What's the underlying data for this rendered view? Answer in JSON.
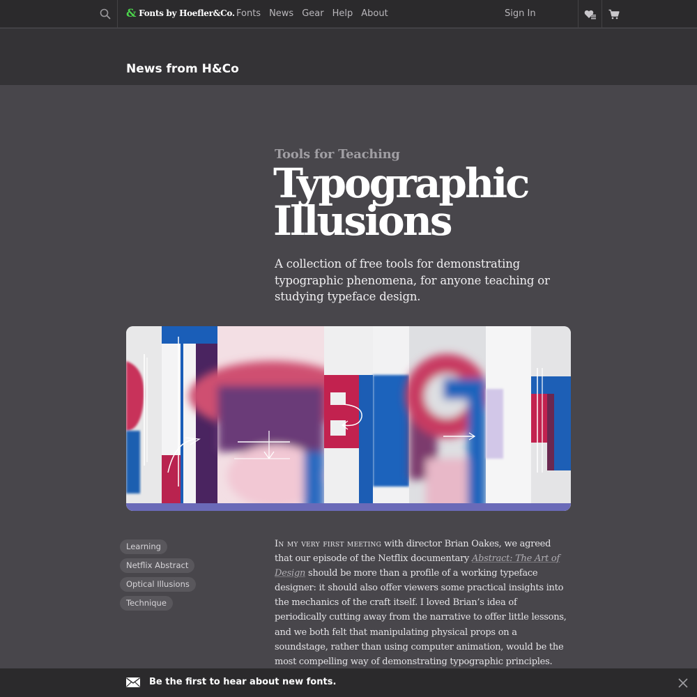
{
  "nav": {
    "brand": "Fonts by Hoefler&Co.",
    "links": [
      "Fonts",
      "News",
      "Gear",
      "Help",
      "About"
    ],
    "sign_in": "Sign In"
  },
  "section": {
    "title": "News from H&Co"
  },
  "article": {
    "kicker": "Tools for Teaching",
    "headline_line1": "Typographic",
    "headline_line2": "Illusions",
    "deck": "A collection of free tools for demonstrating typographic phenomena, for anyone teaching or studying typeface design.",
    "tags": [
      "Learning",
      "Netflix Abstract",
      "Optical Illusions",
      "Technique"
    ],
    "body_lead": "In my very first meeting",
    "body_part1": " with director Brian Oakes, we agreed that our episode of the Netflix documentary ",
    "body_link": "Abstract: The Art of Design",
    "body_part2": " should be more than a profile of a working typeface designer: it should also offer viewers some practical insights into the mechanics of the craft itself. I loved Brian’s idea of periodically cutting away from the narrative to offer little lessons, and we both felt that manipulating physical props on a soundstage, rather than using computer animation, would be the most compelling way of demonstrating typographic principles."
  },
  "newsletter": {
    "text": "Be the first to hear about new fonts."
  },
  "colors": {
    "brand_green": "#4cd44c",
    "background": "#48464b",
    "nav_bg": "#2b2a2c"
  }
}
